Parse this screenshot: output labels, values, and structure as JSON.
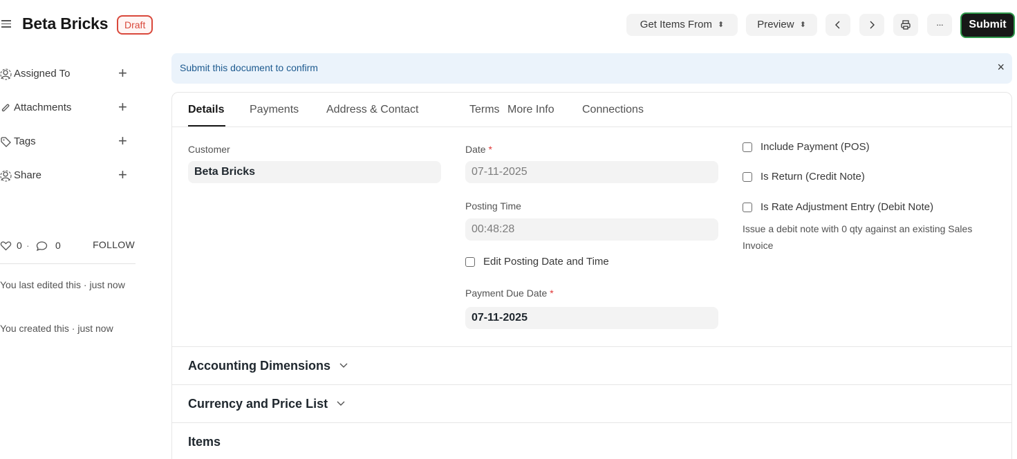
{
  "header": {
    "title": "Beta Bricks",
    "status_badge": "Draft",
    "get_items_label": "Get Items From",
    "preview_label": "Preview",
    "more_label": "···",
    "submit_label": "Submit"
  },
  "sidebar": {
    "items": [
      {
        "label": "Assigned To",
        "icon": "user-add-icon"
      },
      {
        "label": "Attachments",
        "icon": "paperclip-icon"
      },
      {
        "label": "Tags",
        "icon": "tag-icon"
      },
      {
        "label": "Share",
        "icon": "share-user-icon"
      }
    ],
    "likes_count": "0",
    "comments_count": "0",
    "follow_label": "FOLLOW",
    "activity": [
      "You last edited this · just now",
      "You created this · just now"
    ]
  },
  "alert": {
    "message": "Submit this document to confirm",
    "close": "×"
  },
  "tabs": [
    "Details",
    "Payments",
    "Address & Contact",
    "Terms",
    "More Info",
    "Connections"
  ],
  "form": {
    "customer_label": "Customer",
    "customer_value": "Beta Bricks",
    "date_label": "Date",
    "date_value": "07-11-2025",
    "posting_time_label": "Posting Time",
    "posting_time_value": "00:48:28",
    "edit_posting_label": "Edit Posting Date and Time",
    "payment_due_label": "Payment Due Date",
    "payment_due_value": "07-11-2025",
    "include_payment_label": "Include Payment (POS)",
    "is_return_label": "Is Return (Credit Note)",
    "rate_adjustment_label": "Is Rate Adjustment Entry (Debit Note)",
    "rate_adjustment_help": "Issue a debit note with 0 qty against an existing Sales Invoice",
    "required_mark": "*"
  },
  "sections": [
    "Accounting Dimensions",
    "Currency and Price List",
    "Items"
  ]
}
